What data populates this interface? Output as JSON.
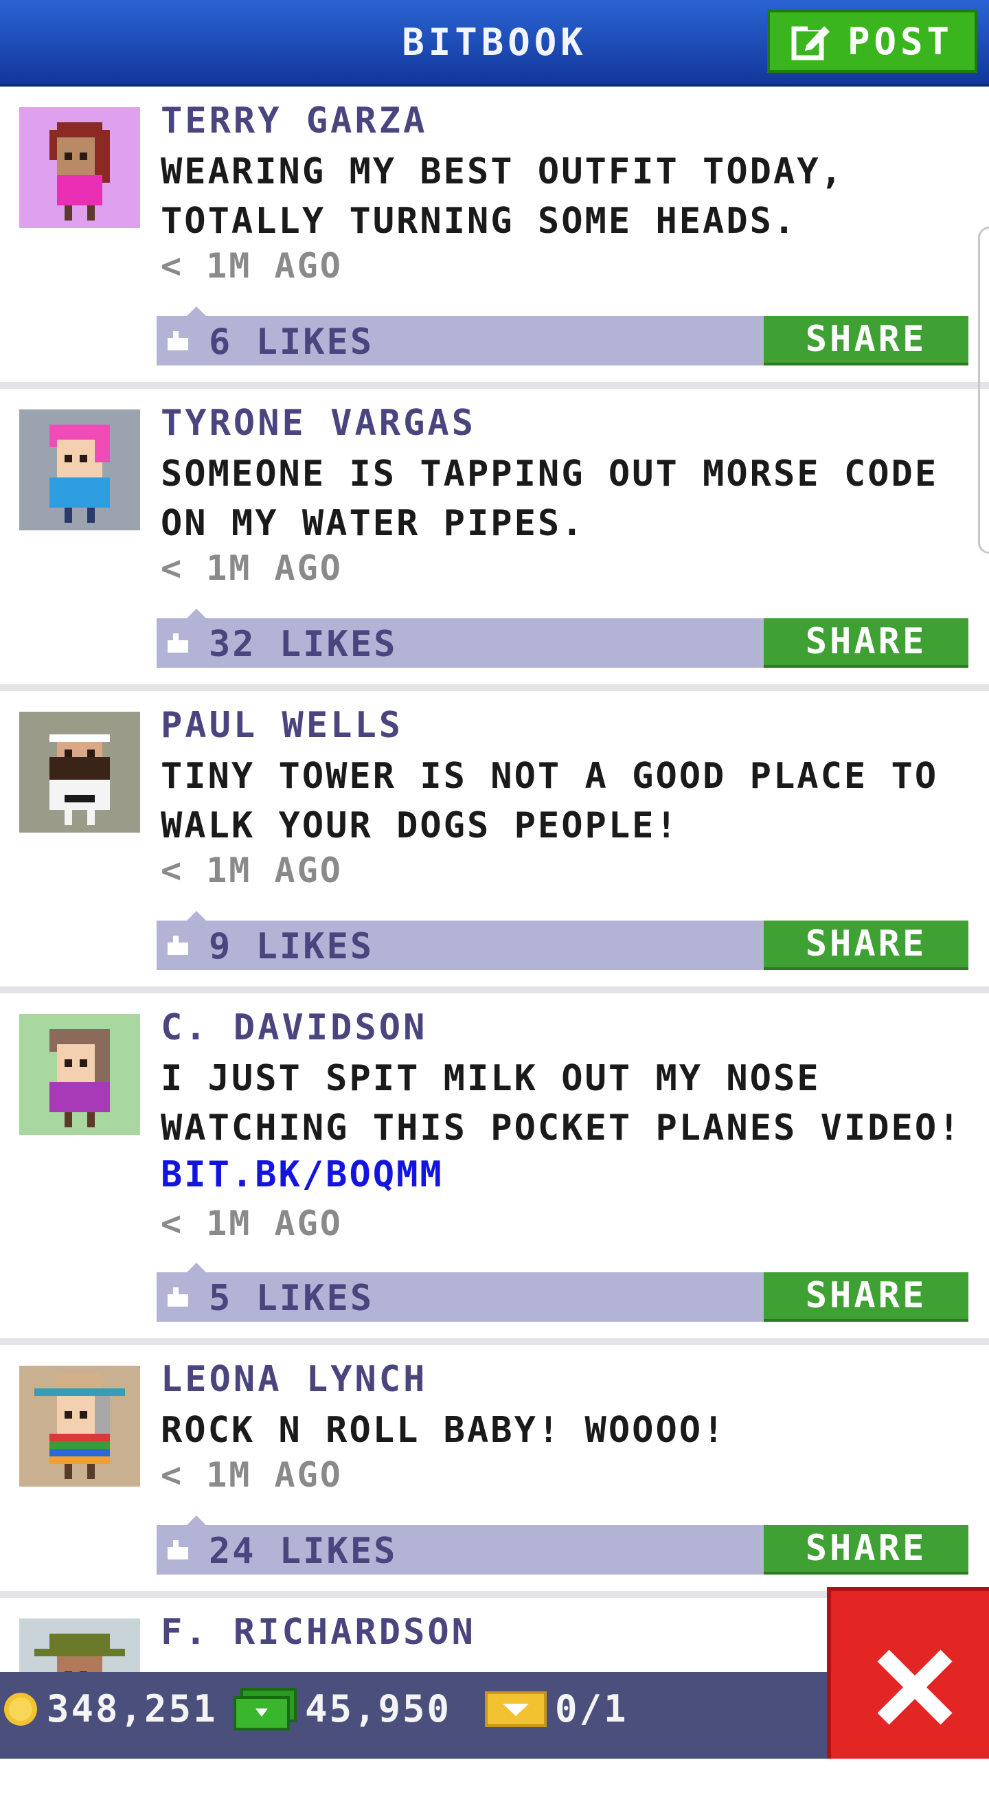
{
  "header": {
    "title": "BITBOOK",
    "post_label": "POST"
  },
  "posts": [
    {
      "name": "TERRY GARZA",
      "text": "WEARING MY BEST OUTFIT TODAY,\nTOTALLY TURNING SOME HEADS.",
      "link": "",
      "time": "< 1M AGO",
      "likes": "6 LIKES",
      "share_label": "SHARE"
    },
    {
      "name": "TYRONE VARGAS",
      "text": "SOMEONE IS TAPPING OUT MORSE CODE\nON MY WATER PIPES.",
      "link": "",
      "time": "< 1M AGO",
      "likes": "32 LIKES",
      "share_label": "SHARE"
    },
    {
      "name": "PAUL WELLS",
      "text": "TINY TOWER IS NOT A GOOD PLACE TO\nWALK YOUR DOGS PEOPLE!",
      "link": "",
      "time": "< 1M AGO",
      "likes": "9 LIKES",
      "share_label": "SHARE"
    },
    {
      "name": "C. DAVIDSON",
      "text": "I JUST SPIT MILK OUT MY NOSE\nWATCHING THIS POCKET PLANES VIDEO!",
      "link": "BIT.BK/BOQMM",
      "time": "< 1M AGO",
      "likes": "5 LIKES",
      "share_label": "SHARE"
    },
    {
      "name": "LEONA LYNCH",
      "text": "ROCK N ROLL BABY! WOOOO!",
      "link": "",
      "time": "< 1M AGO",
      "likes": "24 LIKES",
      "share_label": "SHARE"
    },
    {
      "name": "F. RICHARDSON",
      "text": "",
      "link": "",
      "time": "",
      "likes": "",
      "share_label": ""
    }
  ],
  "status": {
    "coins": "348,251",
    "bux": "45,950",
    "tickets": "0/1"
  },
  "colors": {
    "header": "#1c4cbc",
    "accent_green": "#3fa033",
    "like_bar": "#b3b3d6",
    "name": "#4a457e",
    "link": "#1414e0",
    "close": "#e32524"
  }
}
